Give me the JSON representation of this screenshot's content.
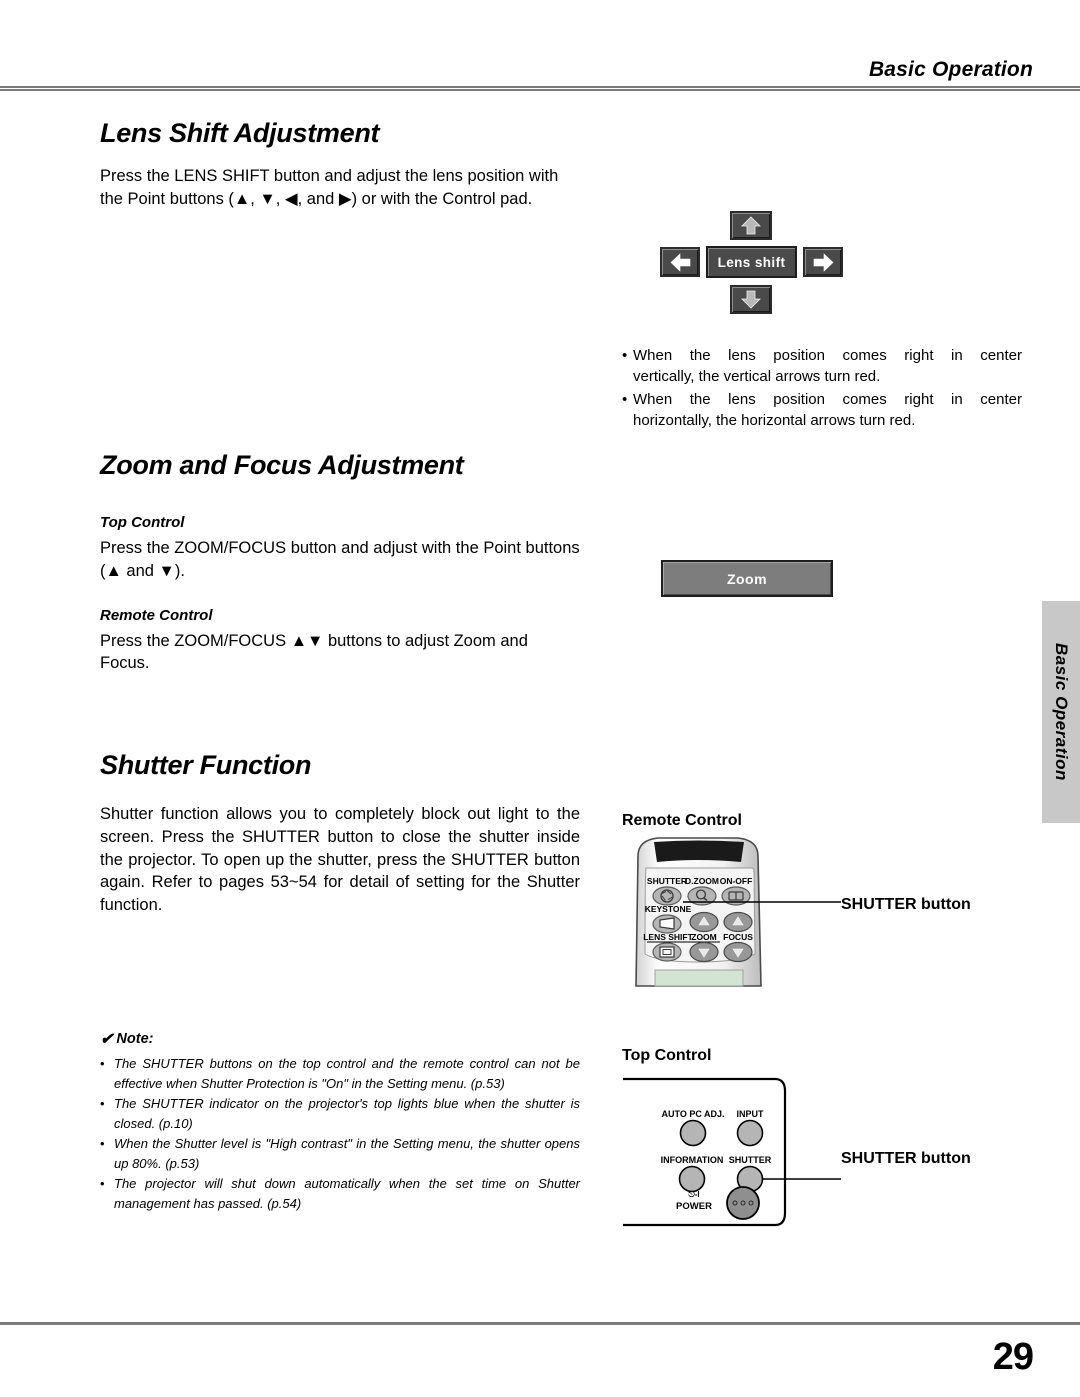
{
  "header": {
    "running_head": "Basic Operation"
  },
  "side_tab": {
    "label": "Basic Operation"
  },
  "footer": {
    "page_number": "29"
  },
  "sections": {
    "lens_shift": {
      "title": "Lens Shift Adjustment",
      "body": "Press the LENS SHIFT button and adjust the lens position with the Point buttons (▲, ▼, ◀, and ▶) or with the Control pad.",
      "widget_label": "Lens shift",
      "notes": [
        {
          "line1": "When the lens position comes right in center",
          "line2": "vertically, the vertical arrows turn red."
        },
        {
          "line1": "When the lens position comes right in center",
          "line2": "horizontally, the horizontal arrows turn red."
        }
      ]
    },
    "zoom_focus": {
      "title": "Zoom and Focus Adjustment",
      "top_control_heading": "Top Control",
      "top_control_body": "Press the ZOOM/FOCUS button and adjust with the Point buttons (▲ and ▼).",
      "remote_control_heading": "Remote Control",
      "remote_control_body": "Press the ZOOM/FOCUS ▲▼ buttons to adjust Zoom and Focus.",
      "widget_label": "Zoom"
    },
    "shutter": {
      "title": "Shutter Function",
      "body": "Shutter function allows you to completely block out light to the screen. Press the SHUTTER button to close the shutter inside the projector. To open up the shutter, press the SHUTTER button again. Refer to pages 53~54 for detail of setting for the Shutter function."
    }
  },
  "note": {
    "heading": "Note:",
    "check_glyph": "✔",
    "items": [
      "The SHUTTER buttons on the top control and the remote control can not be effective when Shutter Protection is \"On\" in the Setting menu. (p.53)",
      "The SHUTTER indicator on the projector's top lights blue when the shutter is closed. (p.10)",
      "When the Shutter level is \"High contrast\" in the Setting menu, the shutter opens up 80%. (p.53)",
      "The projector will shut down automatically when the set time on Shutter management has passed. (p.54)"
    ]
  },
  "diagrams": {
    "remote_control": {
      "heading": "Remote Control",
      "callout": "SHUTTER button",
      "buttons": {
        "shutter": "SHUTTER",
        "dzoom": "D.ZOOM",
        "onoff": "ON-OFF",
        "keystone": "KEYSTONE",
        "lens_shift": "LENS SHIFT",
        "zoom": "ZOOM",
        "focus": "FOCUS"
      }
    },
    "top_control": {
      "heading": "Top Control",
      "callout": "SHUTTER button",
      "buttons": {
        "auto_pc_adj": "AUTO PC ADJ.",
        "input": "INPUT",
        "information": "INFORMATION",
        "shutter": "SHUTTER",
        "power": "POWER",
        "power_symbol": "⏻-I"
      }
    }
  },
  "colors": {
    "rule": "#7b7b7b",
    "tab_bg": "#c8c8c8",
    "widget_dark": "#4a4a4a",
    "widget_mid": "#7d7d7d"
  }
}
